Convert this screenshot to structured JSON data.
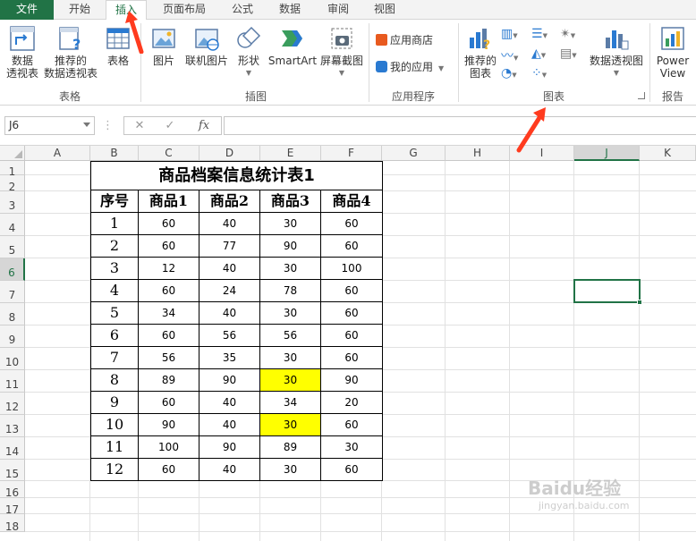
{
  "tabs": [
    {
      "label": "文件"
    },
    {
      "label": "开始"
    },
    {
      "label": "插入"
    },
    {
      "label": "页面布局"
    },
    {
      "label": "公式"
    },
    {
      "label": "数据"
    },
    {
      "label": "审阅"
    },
    {
      "label": "视图"
    }
  ],
  "ribbon": {
    "tables": {
      "group_label": "表格",
      "pivot_line1": "数据",
      "pivot_line2": "透视表",
      "recommended_line1": "推荐的",
      "recommended_line2": "数据透视表",
      "table": "表格"
    },
    "illustrations": {
      "group_label": "插图",
      "pictures": "图片",
      "online_pictures": "联机图片",
      "shapes": "形状",
      "smartart": "SmartArt",
      "screenshot": "屏幕截图"
    },
    "addins": {
      "group_label": "应用程序",
      "store": "应用商店",
      "my_apps": "我的应用"
    },
    "charts": {
      "group_label": "图表",
      "recommended_line1": "推荐的",
      "recommended_line2": "图表",
      "pivot_chart": "数据透视图"
    },
    "reports": {
      "group_label": "报告",
      "power_view_line1": "Power",
      "power_view_line2": "View"
    }
  },
  "formula_bar": {
    "name_box": "J6",
    "cancel": "✕",
    "enter": "✓",
    "fx": "fx",
    "content": ""
  },
  "grid": {
    "columns": [
      "A",
      "B",
      "C",
      "D",
      "E",
      "F",
      "G",
      "H",
      "I",
      "J",
      "K"
    ],
    "rows": [
      "1",
      "2",
      "3",
      "4",
      "5",
      "6",
      "7",
      "8",
      "9",
      "10",
      "11",
      "12",
      "13",
      "14",
      "15",
      "16",
      "17",
      "18"
    ],
    "selected_cell": "J6"
  },
  "table": {
    "title": "商品档案信息统计表1",
    "headers": [
      "序号",
      "商品1",
      "商品2",
      "商品3",
      "商品4"
    ],
    "rows": [
      [
        "1",
        "60",
        "40",
        "30",
        "60"
      ],
      [
        "2",
        "60",
        "77",
        "90",
        "60"
      ],
      [
        "3",
        "12",
        "40",
        "30",
        "100"
      ],
      [
        "4",
        "60",
        "24",
        "78",
        "60"
      ],
      [
        "5",
        "34",
        "40",
        "30",
        "60"
      ],
      [
        "6",
        "60",
        "56",
        "56",
        "60"
      ],
      [
        "7",
        "56",
        "35",
        "30",
        "60"
      ],
      [
        "8",
        "89",
        "90",
        "30",
        "90"
      ],
      [
        "9",
        "60",
        "40",
        "34",
        "20"
      ],
      [
        "10",
        "90",
        "40",
        "30",
        "60"
      ],
      [
        "11",
        "100",
        "90",
        "89",
        "30"
      ],
      [
        "12",
        "60",
        "40",
        "30",
        "60"
      ]
    ],
    "highlighted": [
      [
        7,
        3
      ],
      [
        9,
        3
      ]
    ],
    "highlight_color": "#ffff00"
  },
  "colors": {
    "accent": "#217346",
    "annotation_arrow": "#ff3b1f"
  },
  "watermark": {
    "brand": "Baidu经验",
    "url": "jingyan.baidu.com"
  }
}
